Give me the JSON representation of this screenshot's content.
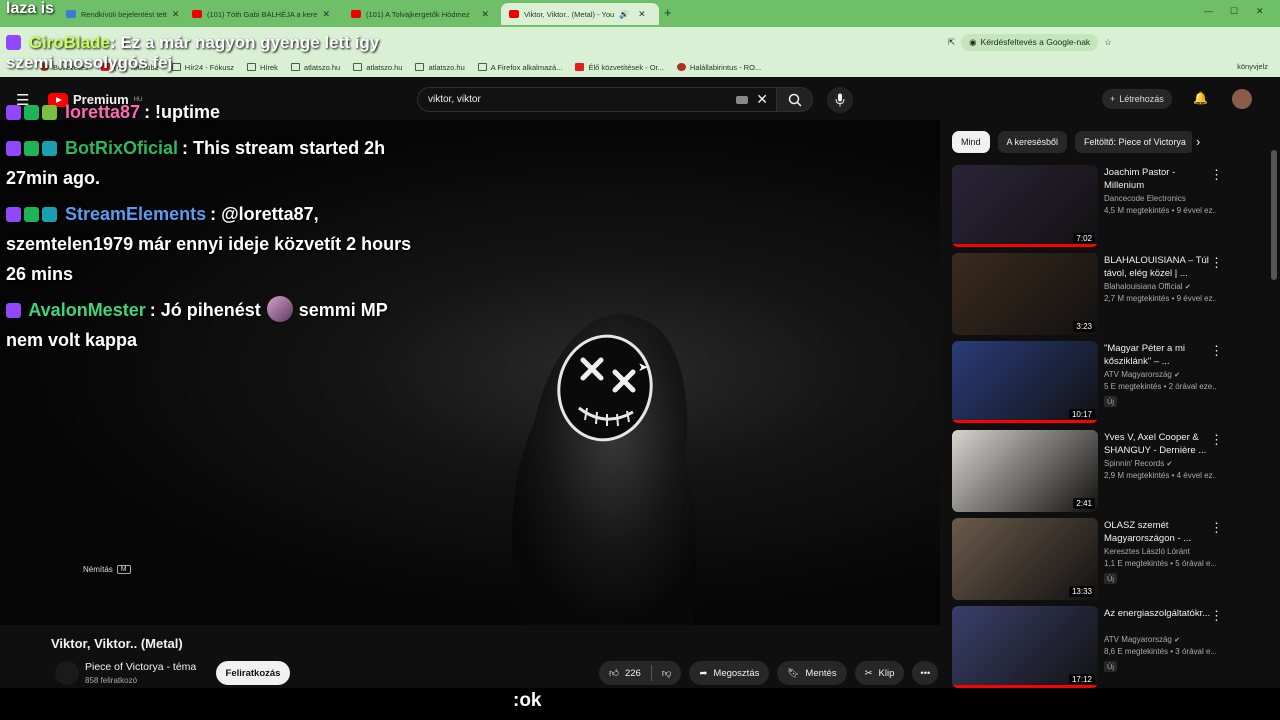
{
  "browser": {
    "tabs": [
      {
        "label": "Rendkívüli bejelentést tett"
      },
      {
        "label": "(101) Tóth Gabi BALHÉJA a kere"
      },
      {
        "label": "(101) A Tolvajkergetők Hódmez"
      },
      {
        "label": "Viktor, Viktor.. (Metal) - You"
      }
    ],
    "omnibox_chip": "Kérdésfeltevés a Google-nak",
    "bookmarks": [
      "Bevezetés",
      "(71) YouTube",
      "Hír24 - Fókusz",
      "Hírek",
      "atlatszo.hu",
      "atlatszo.hu",
      "atlatszo.hu",
      "A Firefox alkalmazá...",
      "Élő közvetítések - Or...",
      "Halállabirintus - RO..."
    ],
    "bookmarks_right": "könyvjelz"
  },
  "overlay": {
    "corner_text": "laza is",
    "top_line_user": "GiroBlade",
    "top_line_text": ": Ez a már nagyon gyenge lett így",
    "top_line_text2": "szemi mosolygós fej",
    "messages": [
      {
        "user": "loretta87",
        "user_color": "#ff69b4",
        "text": ": !uptime"
      },
      {
        "user": "BotRixOficial",
        "user_color": "#2eb85c",
        "text": ": This stream started 2h 27min ago."
      },
      {
        "user": "StreamElements",
        "user_color": "#5b9bf0",
        "text": ": @loretta87, szemtelen1979 már ennyi ideje közvetít 2 hours 26 mins"
      },
      {
        "user": "AvalonMester",
        "user_color": "#3ed67a",
        "text_before": ": Jó pihenést",
        "text_after": "semmi MP nem volt kappa"
      }
    ]
  },
  "youtube": {
    "logo_label": "Premium",
    "logo_region": "HU",
    "search_value": "viktor, viktor",
    "create_label": "Létrehozás",
    "mute_tooltip": "Némítás",
    "mute_key": "M",
    "video_title": "Viktor, Viktor.. (Metal)",
    "channel_name": "Piece of Victorya - téma",
    "channel_subs": "858 feliratkozó",
    "subscribe_label": "Feliratkozás",
    "likes": "226",
    "share_label": "Megosztás",
    "save_label": "Mentés",
    "clip_label": "Klip",
    "subtitle_text": ":ok"
  },
  "sidebar": {
    "chips": [
      "Mind",
      "A keresésből",
      "Feltöltő: Piece of Victorya"
    ],
    "recommendations": [
      {
        "title": "Joachim Pastor - Millenium",
        "channel": "Dancecode Electronics",
        "views": "4,5 M megtekintés • 9 évvel ez...",
        "duration": "7:02",
        "thumb_color": "#2b2438",
        "verified": false,
        "new": false
      },
      {
        "title": "BLAHALOUISIANA – Túl távol, elég közel | ...",
        "channel": "Blahalouisiana Official",
        "views": "2,7 M megtekintés • 9 évvel ez...",
        "duration": "3:23",
        "thumb_color": "#3b2a1e",
        "verified": true,
        "new": false
      },
      {
        "title": "\"Magyar Péter a mi kősziklánk\" – ...",
        "channel": "ATV Magyarország",
        "views": "5 E megtekintés • 2 órával eze...",
        "duration": "10:17",
        "thumb_color": "#2a3c7a",
        "verified": true,
        "new": true,
        "new_label": "Új"
      },
      {
        "title": "Yves V, Axel Cooper & SHANGUY - Dernière ...",
        "channel": "Spinnin' Records",
        "views": "2,9 M megtekintés • 4 évvel ez...",
        "duration": "2:41",
        "thumb_color": "#d8d4d0",
        "verified": true,
        "new": false
      },
      {
        "title": "OLASZ szemét Magyarországon - ...",
        "channel": "Keresztes László Lóránt",
        "views": "1,1 E megtekintés • 5 órával e...",
        "duration": "13:33",
        "thumb_color": "#6b5a4a",
        "verified": false,
        "new": true,
        "new_label": "Új"
      },
      {
        "title": "Az energiaszolgáltatókr...",
        "channel": "ATV Magyarország",
        "views": "8,6 E megtekintés • 3 órával e...",
        "duration": "17:12",
        "thumb_color": "#3a3f6a",
        "verified": true,
        "new": true,
        "new_label": "Új"
      }
    ]
  },
  "colors": {
    "accent": "#ff0000",
    "tabbar": "#6fbf69",
    "toolbar": "#d9f0d4"
  },
  "icons": [
    "search-icon",
    "mic-icon",
    "close-icon",
    "like-icon",
    "dislike-icon",
    "share-icon",
    "save-icon",
    "scissors-icon",
    "more-icon",
    "kebab-icon",
    "chevron-right-icon"
  ]
}
